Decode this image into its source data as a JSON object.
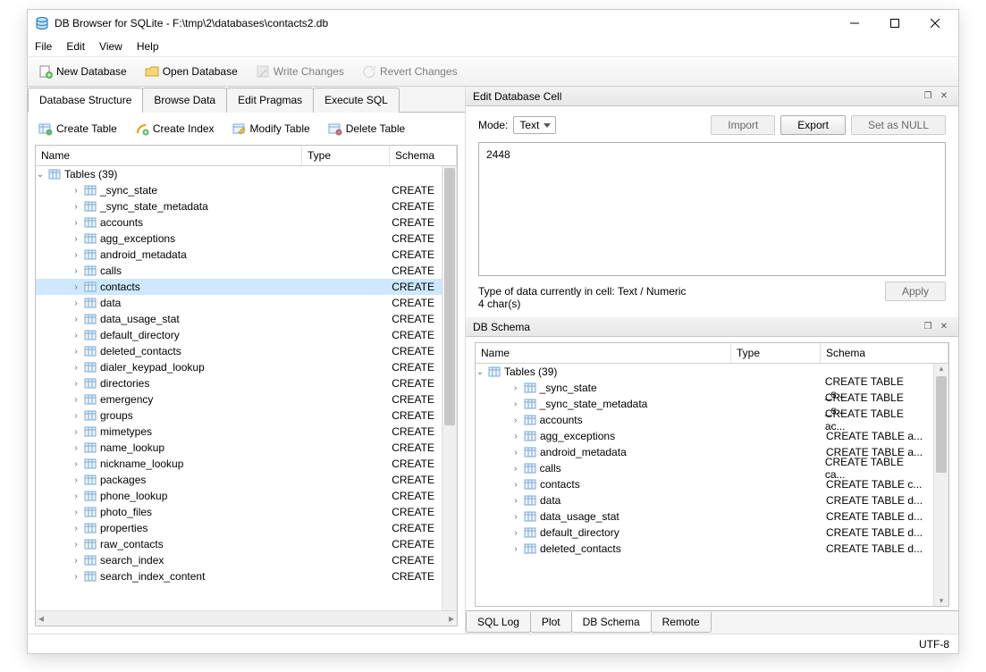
{
  "window": {
    "title": "DB Browser for SQLite - F:\\tmp\\2\\databases\\contacts2.db"
  },
  "menu": [
    "File",
    "Edit",
    "View",
    "Help"
  ],
  "toolbar": {
    "new_db": "New Database",
    "open_db": "Open Database",
    "write": "Write Changes",
    "revert": "Revert Changes"
  },
  "left": {
    "tabs": [
      "Database Structure",
      "Browse Data",
      "Edit Pragmas",
      "Execute SQL"
    ],
    "active_tab": 0,
    "buttons": {
      "create_table": "Create Table",
      "create_index": "Create Index",
      "modify_table": "Modify Table",
      "delete_table": "Delete Table"
    },
    "cols": {
      "name": "Name",
      "type": "Type",
      "schema": "Schema"
    },
    "root": "Tables (39)",
    "rows": [
      {
        "name": "_sync_state",
        "schema": "CREATE",
        "selected": false
      },
      {
        "name": "_sync_state_metadata",
        "schema": "CREATE",
        "selected": false
      },
      {
        "name": "accounts",
        "schema": "CREATE",
        "selected": false
      },
      {
        "name": "agg_exceptions",
        "schema": "CREATE",
        "selected": false
      },
      {
        "name": "android_metadata",
        "schema": "CREATE",
        "selected": false
      },
      {
        "name": "calls",
        "schema": "CREATE",
        "selected": false
      },
      {
        "name": "contacts",
        "schema": "CREATE",
        "selected": true
      },
      {
        "name": "data",
        "schema": "CREATE",
        "selected": false
      },
      {
        "name": "data_usage_stat",
        "schema": "CREATE",
        "selected": false
      },
      {
        "name": "default_directory",
        "schema": "CREATE",
        "selected": false
      },
      {
        "name": "deleted_contacts",
        "schema": "CREATE",
        "selected": false
      },
      {
        "name": "dialer_keypad_lookup",
        "schema": "CREATE",
        "selected": false
      },
      {
        "name": "directories",
        "schema": "CREATE",
        "selected": false
      },
      {
        "name": "emergency",
        "schema": "CREATE",
        "selected": false
      },
      {
        "name": "groups",
        "schema": "CREATE",
        "selected": false
      },
      {
        "name": "mimetypes",
        "schema": "CREATE",
        "selected": false
      },
      {
        "name": "name_lookup",
        "schema": "CREATE",
        "selected": false
      },
      {
        "name": "nickname_lookup",
        "schema": "CREATE",
        "selected": false
      },
      {
        "name": "packages",
        "schema": "CREATE",
        "selected": false
      },
      {
        "name": "phone_lookup",
        "schema": "CREATE",
        "selected": false
      },
      {
        "name": "photo_files",
        "schema": "CREATE",
        "selected": false
      },
      {
        "name": "properties",
        "schema": "CREATE",
        "selected": false
      },
      {
        "name": "raw_contacts",
        "schema": "CREATE",
        "selected": false
      },
      {
        "name": "search_index",
        "schema": "CREATE",
        "selected": false
      },
      {
        "name": "search_index_content",
        "schema": "CREATE",
        "selected": false
      }
    ]
  },
  "cell": {
    "title": "Edit Database Cell",
    "mode_label": "Mode:",
    "mode_value": "Text",
    "import": "Import",
    "export": "Export",
    "set_null": "Set as NULL",
    "value": "2448",
    "type_line": "Type of data currently in cell: Text / Numeric",
    "char_line": "4 char(s)",
    "apply": "Apply"
  },
  "schema": {
    "title": "DB Schema",
    "cols": {
      "name": "Name",
      "type": "Type",
      "schema": "Schema"
    },
    "root": "Tables (39)",
    "rows": [
      {
        "name": "_sync_state",
        "schema": "CREATE TABLE _s..."
      },
      {
        "name": "_sync_state_metadata",
        "schema": "CREATE TABLE _s..."
      },
      {
        "name": "accounts",
        "schema": "CREATE TABLE ac..."
      },
      {
        "name": "agg_exceptions",
        "schema": "CREATE TABLE a..."
      },
      {
        "name": "android_metadata",
        "schema": "CREATE TABLE a..."
      },
      {
        "name": "calls",
        "schema": "CREATE TABLE ca..."
      },
      {
        "name": "contacts",
        "schema": "CREATE TABLE c..."
      },
      {
        "name": "data",
        "schema": "CREATE TABLE d..."
      },
      {
        "name": "data_usage_stat",
        "schema": "CREATE TABLE d..."
      },
      {
        "name": "default_directory",
        "schema": "CREATE TABLE d..."
      },
      {
        "name": "deleted_contacts",
        "schema": "CREATE TABLE d..."
      }
    ]
  },
  "bottom_tabs": [
    "SQL Log",
    "Plot",
    "DB Schema",
    "Remote"
  ],
  "bottom_active": 2,
  "status": "UTF-8"
}
